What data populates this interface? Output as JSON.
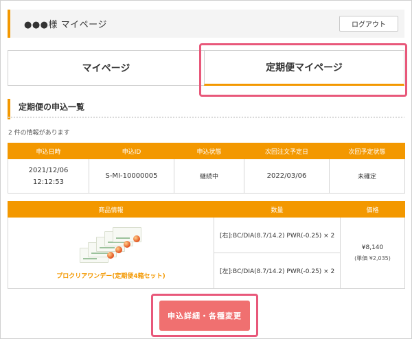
{
  "header": {
    "title": "●●●様 マイページ",
    "logout_label": "ログアウト"
  },
  "tabs": [
    {
      "label": "マイページ",
      "active": false
    },
    {
      "label": "定期便マイページ",
      "active": true
    }
  ],
  "section": {
    "heading": "定期便の申込一覧",
    "count_text": "2 件の情報があります"
  },
  "subscriptions_table": {
    "headers": [
      "申込日時",
      "申込ID",
      "申込状態",
      "次回注文予定日",
      "次回予定状態"
    ],
    "rows": [
      {
        "date": "2021/12/06",
        "time": "12:12:53",
        "id": "S-MI-10000005",
        "status": "継続中",
        "next_date": "2022/03/06",
        "next_status": "未確定"
      }
    ]
  },
  "items_table": {
    "headers": [
      "商品情報",
      "数量",
      "価格"
    ],
    "product_name": "プロクリアワンデー(定期便4箱セット)",
    "specs": [
      "[右]:BC/DIA(8.7/14.2) PWR(-0.25) × 2",
      "[左]:BC/DIA(8.7/14.2) PWR(-0.25) × 2"
    ],
    "price": "¥8,140",
    "unit_price": "(単価 ¥2,035)"
  },
  "actions": {
    "detail_button": "申込詳細・各種変更"
  },
  "colors": {
    "accent": "#f39800",
    "highlight": "#e8587a",
    "button": "#f07070"
  }
}
